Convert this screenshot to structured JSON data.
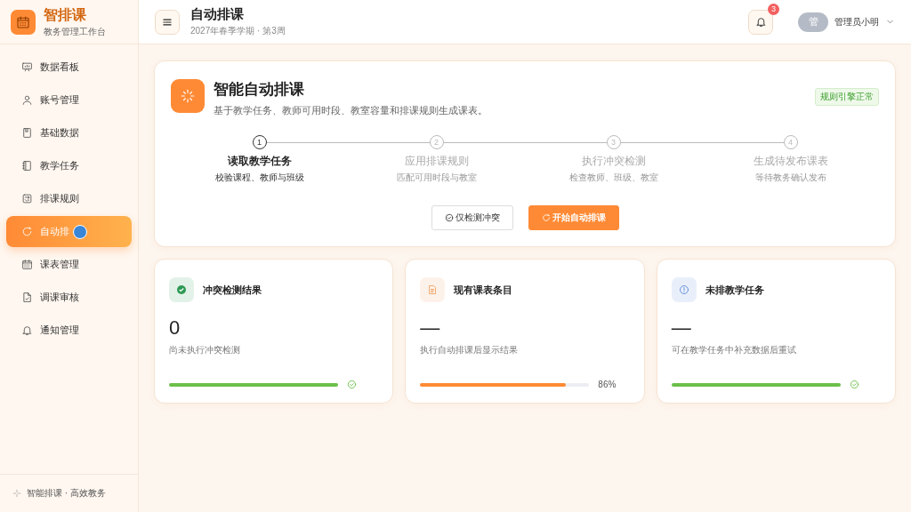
{
  "brand": {
    "name": "智排课",
    "subtitle": "教务管理工作台"
  },
  "sidebar": {
    "items": [
      {
        "label": "数据看板",
        "selected": false
      },
      {
        "label": "账号管理",
        "selected": false
      },
      {
        "label": "基础数据",
        "selected": false
      },
      {
        "label": "教学任务",
        "selected": false
      },
      {
        "label": "排课规则",
        "selected": false
      },
      {
        "label": "自动排",
        "selected": true
      },
      {
        "label": "课表管理",
        "selected": false
      },
      {
        "label": "调课审核",
        "selected": false
      },
      {
        "label": "通知管理",
        "selected": false
      }
    ],
    "footer": "智能排课 · 高效教务"
  },
  "header": {
    "title": "自动排课",
    "subtitle": "2027年春季学期 · 第3周",
    "notifications": "3",
    "avatar": "管",
    "user": "管理员小明"
  },
  "hero": {
    "title": "智能自动排课",
    "description": "基于教学任务、教师可用时段、教室容量和排课规则生成课表。",
    "status": "规则引擎正常",
    "steps": [
      {
        "number": "1",
        "title": "读取教学任务",
        "detail": "校验课程、教师与班级",
        "active": true
      },
      {
        "number": "2",
        "title": "应用排课规则",
        "detail": "匹配可用时段与教室",
        "active": false
      },
      {
        "number": "3",
        "title": "执行冲突检测",
        "detail": "检查教师、班级、教室",
        "active": false
      },
      {
        "number": "4",
        "title": "生成待发布课表",
        "detail": "等待教务确认发布",
        "active": false
      }
    ],
    "buttons": [
      {
        "label": "仅检测冲突",
        "kind": "secondary"
      },
      {
        "label": "开始自动排课",
        "kind": "primary"
      }
    ]
  },
  "cards": [
    {
      "kind": "check",
      "title": "冲突检测结果",
      "value": "0",
      "note": "尚未执行冲突检测",
      "level": 1
    },
    {
      "kind": "progress",
      "title": "现有课表条目",
      "value": "—",
      "note": "执行自动排课后显示结果",
      "level": 0.86,
      "reading": "86%"
    },
    {
      "kind": "info",
      "title": "未排教学任务",
      "value": "—",
      "note": "可在教学任务中补充数据后重试",
      "level": 1
    }
  ]
}
